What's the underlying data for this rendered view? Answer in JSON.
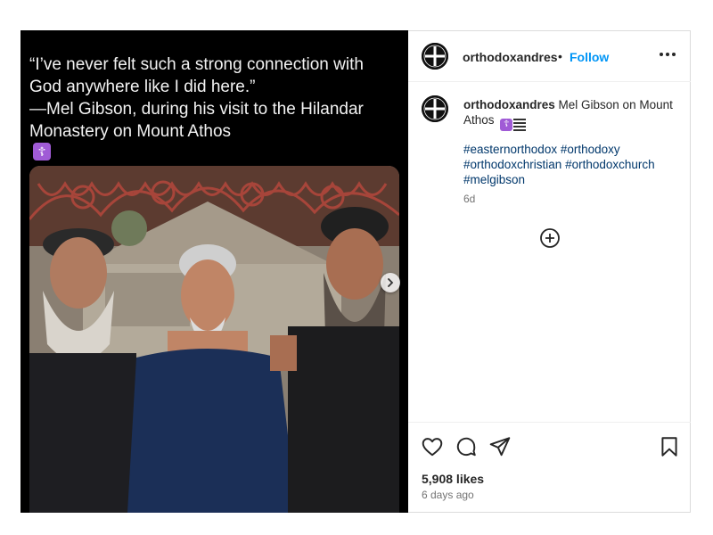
{
  "post": {
    "quote_lines": [
      "“I’ve never felt such a strong connection with",
      "God anywhere like I did here.”",
      "—Mel Gibson, during his visit to the Hilandar",
      "Monastery on Mount Athos"
    ],
    "quote_emoji": "☦"
  },
  "header": {
    "username": "orthodoxandres",
    "separator": "•",
    "follow_label": "Follow"
  },
  "caption": {
    "username": "orthodoxandres",
    "text": "Mel Gibson on Mount Athos",
    "hashtags": [
      "#easternorthodox",
      "#orthodoxy",
      "#orthodoxchristian",
      "#orthodoxchurch",
      "#melgibson"
    ],
    "time": "6d"
  },
  "footer": {
    "likes": "5,908 likes",
    "posted": "6 days ago"
  },
  "colors": {
    "follow": "#0095f6",
    "hashtag": "#00376b",
    "emoji_purple": "#a05bd6"
  },
  "icons": [
    "avatar-cross-icon",
    "more-options-icon",
    "load-more-comments-icon",
    "heart-icon",
    "comment-icon",
    "share-icon",
    "bookmark-icon",
    "carousel-next-icon"
  ]
}
